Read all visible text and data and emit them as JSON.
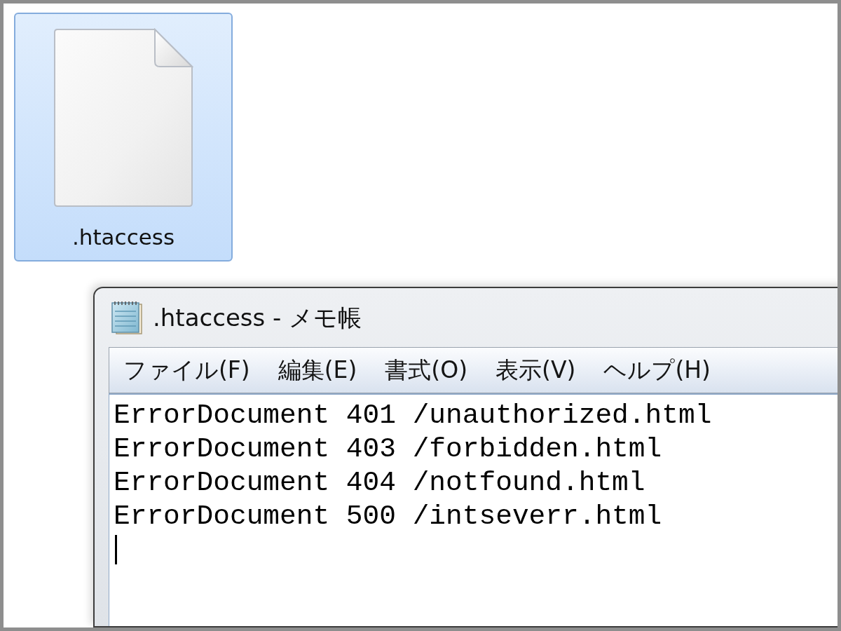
{
  "explorer": {
    "file": {
      "name": ".htaccess",
      "selected": true
    }
  },
  "notepad": {
    "title": ".htaccess - メモ帳",
    "menu": [
      {
        "label": "ファイル(F)"
      },
      {
        "label": "編集(E)"
      },
      {
        "label": "書式(O)"
      },
      {
        "label": "表示(V)"
      },
      {
        "label": "ヘルプ(H)"
      }
    ],
    "editor": {
      "lines": [
        "ErrorDocument 401 /unauthorized.html",
        "ErrorDocument 403 /forbidden.html",
        "ErrorDocument 404 /notfound.html",
        "ErrorDocument 500 /intseverr.html"
      ],
      "caret": true
    }
  }
}
